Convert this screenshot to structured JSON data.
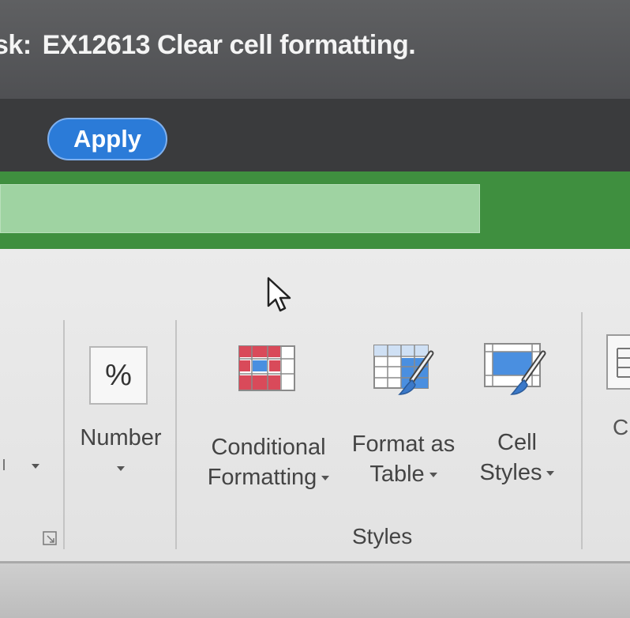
{
  "task": {
    "prefix": "sk:",
    "text": "EX12613 Clear cell formatting."
  },
  "apply_button": {
    "label": "Apply",
    "color": "#2b7bd8"
  },
  "ribbon": {
    "number_group": {
      "icon": "percent-icon",
      "icon_glyph": "%",
      "label": "Number"
    },
    "conditional_formatting": {
      "line1": "Conditional",
      "line2": "Formatting",
      "icon": "conditional-formatting-icon"
    },
    "format_as_table": {
      "line1": "Format as",
      "line2": "Table",
      "icon": "format-as-table-icon"
    },
    "cell_styles": {
      "line1": "Cell",
      "line2": "Styles",
      "icon": "cell-styles-icon"
    },
    "styles_group_label": "Styles",
    "cells_partial_label": "C"
  },
  "colors": {
    "ribbon_accent_green": "#3f8f3f",
    "input_green": "#9fd3a2"
  }
}
